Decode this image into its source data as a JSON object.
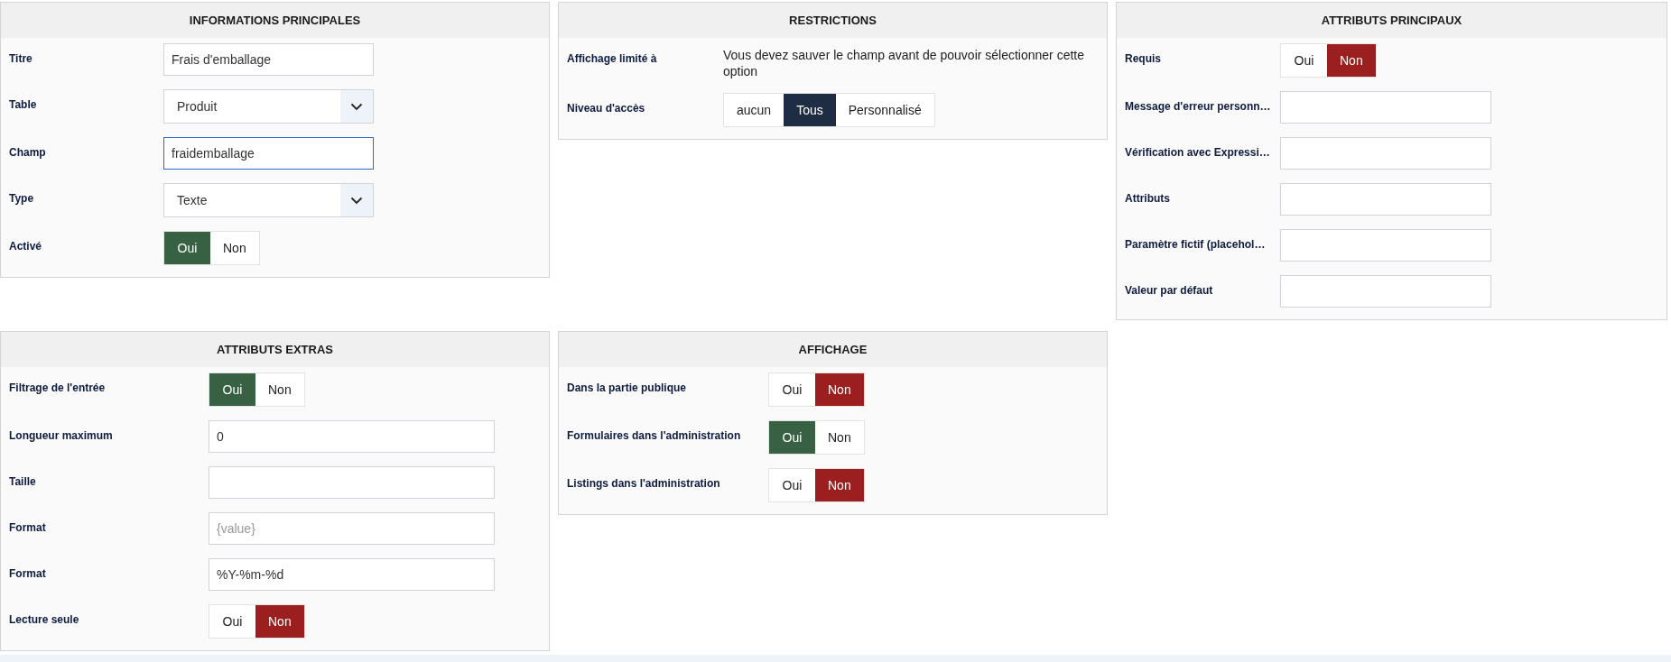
{
  "panels": [
    {
      "title": "INFORMATIONS PRINCIPALES",
      "rows": [
        {
          "label": "Titre",
          "kind": "text",
          "value": "Frais d'emballage",
          "focused": false
        },
        {
          "label": "Table",
          "kind": "select",
          "value": "Produit"
        },
        {
          "label": "Champ",
          "kind": "text",
          "value": "fraidemballage",
          "focused": true
        },
        {
          "label": "Type",
          "kind": "select",
          "value": "Texte"
        },
        {
          "label": "Activé",
          "kind": "toggle",
          "options": [
            {
              "label": "Oui",
              "kind": "yes",
              "selected": true
            },
            {
              "label": "Non",
              "kind": "no",
              "selected": false
            }
          ]
        }
      ]
    },
    {
      "title": "RESTRICTIONS",
      "rows": [
        {
          "label": "Affichage limité à",
          "kind": "note",
          "text": "Vous devez sauver le champ avant de pouvoir sélectionner cette option"
        },
        {
          "label": "Niveau d'accès",
          "kind": "toggle",
          "options": [
            {
              "label": "aucun",
              "kind": "choice",
              "selected": false
            },
            {
              "label": "Tous",
              "kind": "choice",
              "selected": true
            },
            {
              "label": "Personnalisé",
              "kind": "choice",
              "selected": false
            }
          ]
        }
      ]
    },
    {
      "title": "ATTRIBUTS PRINCIPAUX",
      "rows": [
        {
          "label": "Requis",
          "kind": "toggle",
          "options": [
            {
              "label": "Oui",
              "kind": "yes",
              "selected": false
            },
            {
              "label": "Non",
              "kind": "no",
              "selected": true
            }
          ]
        },
        {
          "label": "Message d'erreur personn…",
          "kind": "text",
          "focused": false
        },
        {
          "label": "Vérification avec Expressi…",
          "kind": "text",
          "focused": false
        },
        {
          "label": "Attributs",
          "kind": "text",
          "focused": false
        },
        {
          "label": "Paramètre fictif (placehol…",
          "kind": "text",
          "focused": false
        },
        {
          "label": "Valeur par défaut",
          "kind": "text",
          "focused": false
        }
      ]
    },
    {
      "title": "ATTRIBUTS EXTRAS",
      "rows": [
        {
          "label": "Filtrage de l'entrée",
          "kind": "toggle",
          "options": [
            {
              "label": "Oui",
              "kind": "yes",
              "selected": true
            },
            {
              "label": "Non",
              "kind": "no",
              "selected": false
            }
          ]
        },
        {
          "label": "Longueur maximum",
          "kind": "text",
          "value": "0",
          "focused": false
        },
        {
          "label": "Taille",
          "kind": "text",
          "focused": false
        },
        {
          "label": "Format",
          "kind": "text",
          "placeholder": "{value}",
          "focused": false
        },
        {
          "label": "Format",
          "kind": "text",
          "value": "%Y-%m-%d",
          "focused": false
        },
        {
          "label": "Lecture seule",
          "kind": "toggle",
          "options": [
            {
              "label": "Oui",
              "kind": "yes",
              "selected": false
            },
            {
              "label": "Non",
              "kind": "no",
              "selected": true
            }
          ]
        }
      ]
    },
    {
      "title": "AFFICHAGE",
      "rows": [
        {
          "label": "Dans la partie publique",
          "kind": "toggle",
          "options": [
            {
              "label": "Oui",
              "kind": "yes",
              "selected": false
            },
            {
              "label": "Non",
              "kind": "no",
              "selected": true
            }
          ]
        },
        {
          "label": "Formulaires dans l'administration",
          "kind": "toggle",
          "options": [
            {
              "label": "Oui",
              "kind": "yes",
              "selected": true
            },
            {
              "label": "Non",
              "kind": "no",
              "selected": false
            }
          ]
        },
        {
          "label": "Listings dans l'administration",
          "kind": "toggle",
          "options": [
            {
              "label": "Oui",
              "kind": "yes",
              "selected": false
            },
            {
              "label": "Non",
              "kind": "no",
              "selected": true
            }
          ]
        }
      ]
    }
  ]
}
